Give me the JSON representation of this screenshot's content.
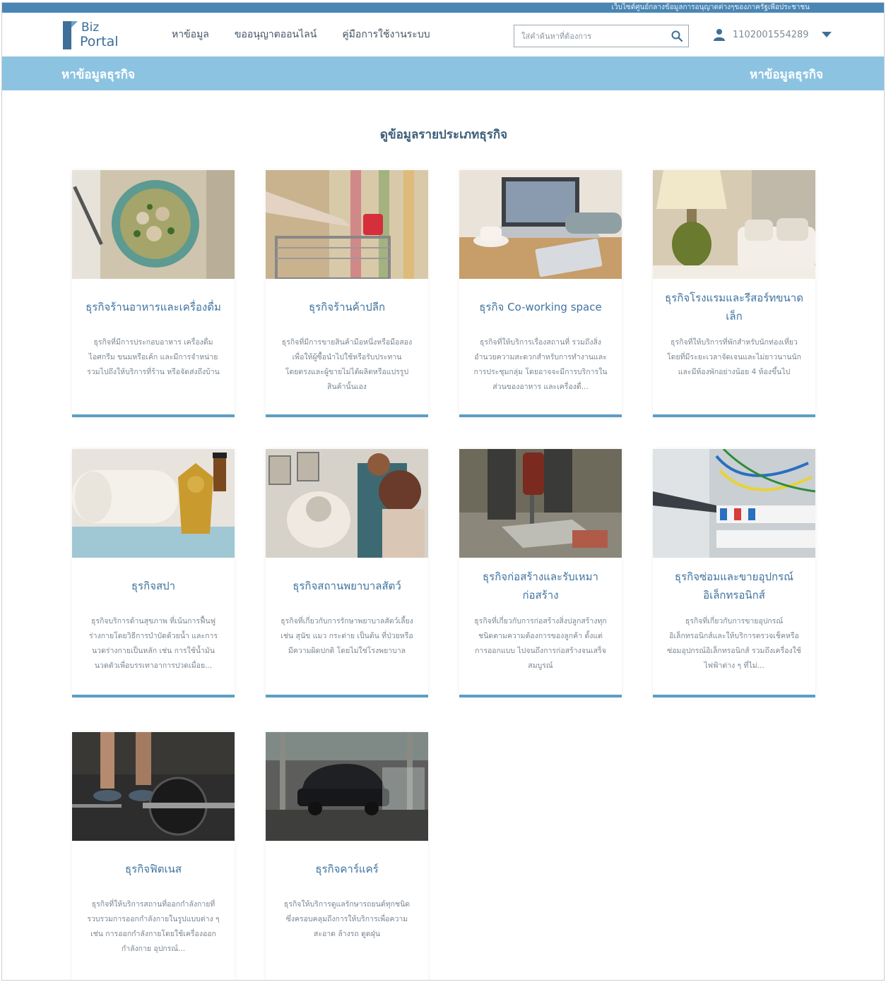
{
  "topstrip_text": "เว็บไซต์ศูนย์กลางข้อมูลการอนุญาตต่างๆของภาครัฐเพื่อประชาชน",
  "logo": {
    "line1": "Biz",
    "line2": "Portal"
  },
  "nav": [
    "หาข้อมูล",
    "ขออนุญาตออนไลน์",
    "คู่มือการใช้งานระบบ"
  ],
  "search": {
    "placeholder": "ใส่คำค้นหาที่ต้องการ",
    "value": ""
  },
  "user": {
    "id": "1102001554289"
  },
  "banner": {
    "left": "หาข้อมูลธุรกิจ",
    "right": "หาข้อมูลธุรกิจ"
  },
  "section_title": "ดูข้อมูลรายประเภทธุรกิจ",
  "colors": {
    "brand": "#3d6f98",
    "banner": "#8cc3e1",
    "accent_line": "#5d9ec6",
    "title": "#3f73a0"
  },
  "cards": [
    {
      "title": "ธุรกิจร้านอาหารและเครื่องดื่ม",
      "desc": "ธุรกิจที่มีการประกอบอาหาร เครื่องดื่ม ไอศกรีม ขนมหรือเค้ก และมีการจำหน่ายรวมไปถึงให้บริการที่ร้าน หรือจัดส่งถึงบ้าน",
      "image": "green-curry-bowl"
    },
    {
      "title": "ธุรกิจร้านค้าปลีก",
      "desc": "ธุรกิจที่มีการขายสินค้ามือหนึ่งหรือมือสองเพื่อให้ผู้ซื้อนำไปใช้หรือรับประทานโดยตรงและผู้ขายไม่ได้ผลิตหรือแปรรูปสินค้านั้นเอง",
      "image": "shopping-cart"
    },
    {
      "title": "ธุรกิจ Co-working space",
      "desc": "ธุรกิจที่ให้บริการเรื่องสถานที่ รวมถึงสิ่งอำนวยความสะดวกสำหรับการทำงานและการประชุมกลุ่ม โดยอาจจะมีการบริการในส่วนของอาหาร และเครื่องดื่...",
      "image": "laptop-coffee"
    },
    {
      "title": "ธุรกิจโรงแรมและรีสอร์ทขนาดเล็ก",
      "desc": "ธุรกิจที่ให้บริการที่พักสำหรับนักท่องเที่ยวโดยที่มีระยะเวลาจัดเจนและไม่ยาวนานนักและมีห้องพักอย่างน้อย 4 ห้องขึ้นไป",
      "image": "hotel-room"
    },
    {
      "title": "ธุรกิจสปา",
      "desc": "ธุรกิจบริการด้านสุขภาพ ที่เน้นการฟื้นฟูร่างกายโดยวิธีการบำบัดด้วยน้ำ และการนวดร่างกายเป็นหลัก เช่น การใช้น้ำมันนวดตัวเพื่อบรรเทาอาการปวดเมื่อย...",
      "image": "spa-towel"
    },
    {
      "title": "ธุรกิจสถานพยาบาลสัตว์",
      "desc": "ธุรกิจที่เกี่ยวกับการรักษาพยาบาลสัตว์เลี้ยง เช่น สุนัข แมว กระต่าย เป็นต้น ที่ป่วยหรือมีความผิดปกติ โดยไม่ใช่โรงพยาบาล",
      "image": "vet-dog"
    },
    {
      "title": "ธุรกิจก่อสร้างและรับเหมาก่อสร้าง",
      "desc": "ธุรกิจที่เกี่ยวกับการก่อสร้างสิ่งปลูกสร้างทุกชนิดตามความต้องการของลูกค้า ตั้งแต่การออกแบบ ไปจนถึงการก่อสร้างจนเสร็จสมบูรณ์",
      "image": "construction-drill"
    },
    {
      "title": "ธุรกิจซ่อมและขายอุปกรณ์อิเล็กทรอนิกส์",
      "desc": "ธุรกิจที่เกี่ยวกับการขายอุปกรณ์อิเล็กทรอนิกส์และให้บริการตรวจเช็คหรือซ่อมอุปกรณ์อิเล็กทรอนิกส์ รวมถึงเครื่องใช้ไฟฟ้าต่าง ๆ ที่ไม่...",
      "image": "electrical-panel"
    },
    {
      "title": "ธุรกิจฟิตเนส",
      "desc": "ธุรกิจที่ให้บริการสถานที่ออกกำลังกายที่รวบรวมการออกกำลังกายในรูปแบบต่าง ๆ เช่น การออกกำลังกายโดยใช้เครื่องออกกำลังกาย อุปกรณ์...",
      "image": "barbell"
    },
    {
      "title": "ธุรกิจคาร์แคร์",
      "desc": "ธุรกิจให้บริการดูแลรักษารถยนต์ทุกชนิด ซึ่งครอบคลุมถึงการให้บริการเพื่อความสะอาด ล้างรถ ดูดฝุ่น",
      "image": "car-wash"
    }
  ]
}
